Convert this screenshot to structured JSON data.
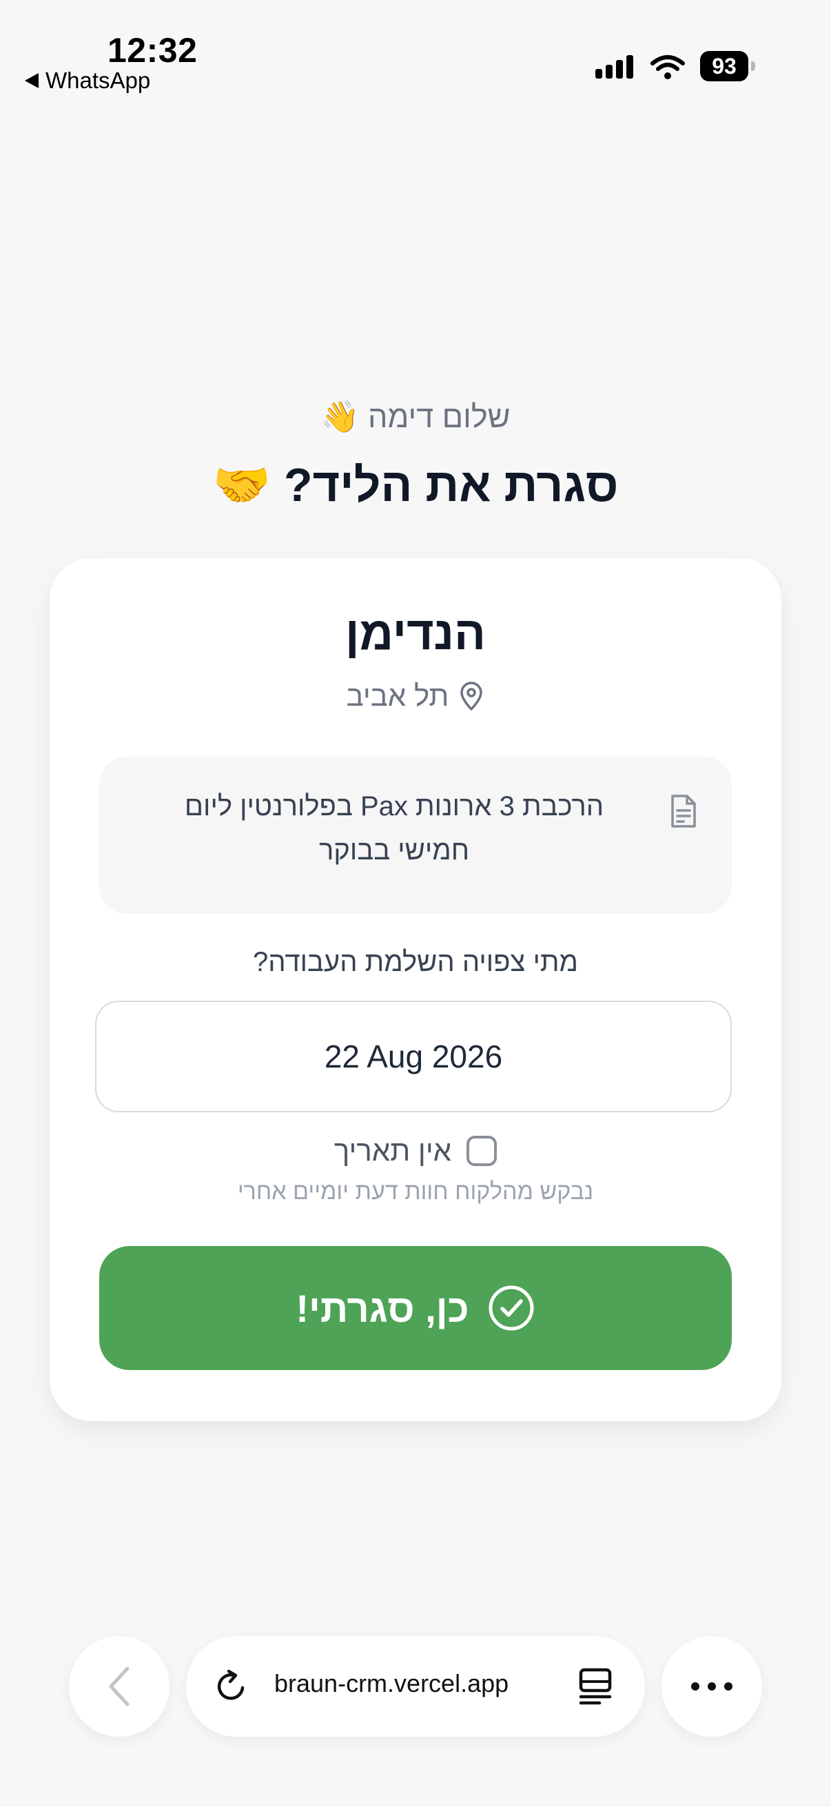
{
  "status_bar": {
    "time": "12:32",
    "back_app": "WhatsApp",
    "battery": "93",
    "icons": [
      "signal-icon",
      "wifi-icon",
      "battery-icon"
    ]
  },
  "header": {
    "greeting": "שלום דימה 👋",
    "title": "סגרת את הליד? 🤝"
  },
  "card": {
    "lead_name": "הנדימן",
    "location": "תל אביב",
    "description": "הרכבת 3 ארונות Pax בפלורנטין ליום חמישי בבוקר",
    "completion_question": "מתי צפויה השלמת העבודה?",
    "completion_date": "22 Aug 2026",
    "no_date_label": "אין תאריך",
    "no_date_checked": false,
    "hint": "נבקש מהלקוח חוות דעת יומיים אחרי",
    "confirm_button": "כן, סגרתי!"
  },
  "browser": {
    "url": "braun-crm.vercel.app"
  },
  "colors": {
    "confirm_button": "#4ea356",
    "background": "#f7f7f8"
  }
}
